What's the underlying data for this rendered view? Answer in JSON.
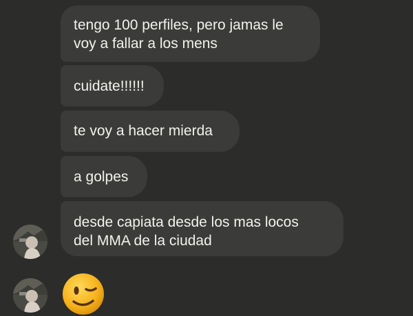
{
  "messages": [
    {
      "text": "tengo 100 perfiles, pero jamas le\nvoy a fallar a los mens"
    },
    {
      "text": "cuidate!!!!!!"
    },
    {
      "text": "te voy a hacer mierda"
    },
    {
      "text": "a golpes"
    },
    {
      "text": "desde capiata desde los mas locos\ndel MMA  de la ciudad"
    }
  ],
  "emoji_message": {
    "icon": "winking-face-emoji"
  },
  "colors": {
    "background": "#2c2c2a",
    "bubble": "#3b3b39",
    "text": "#f2f2ee"
  }
}
